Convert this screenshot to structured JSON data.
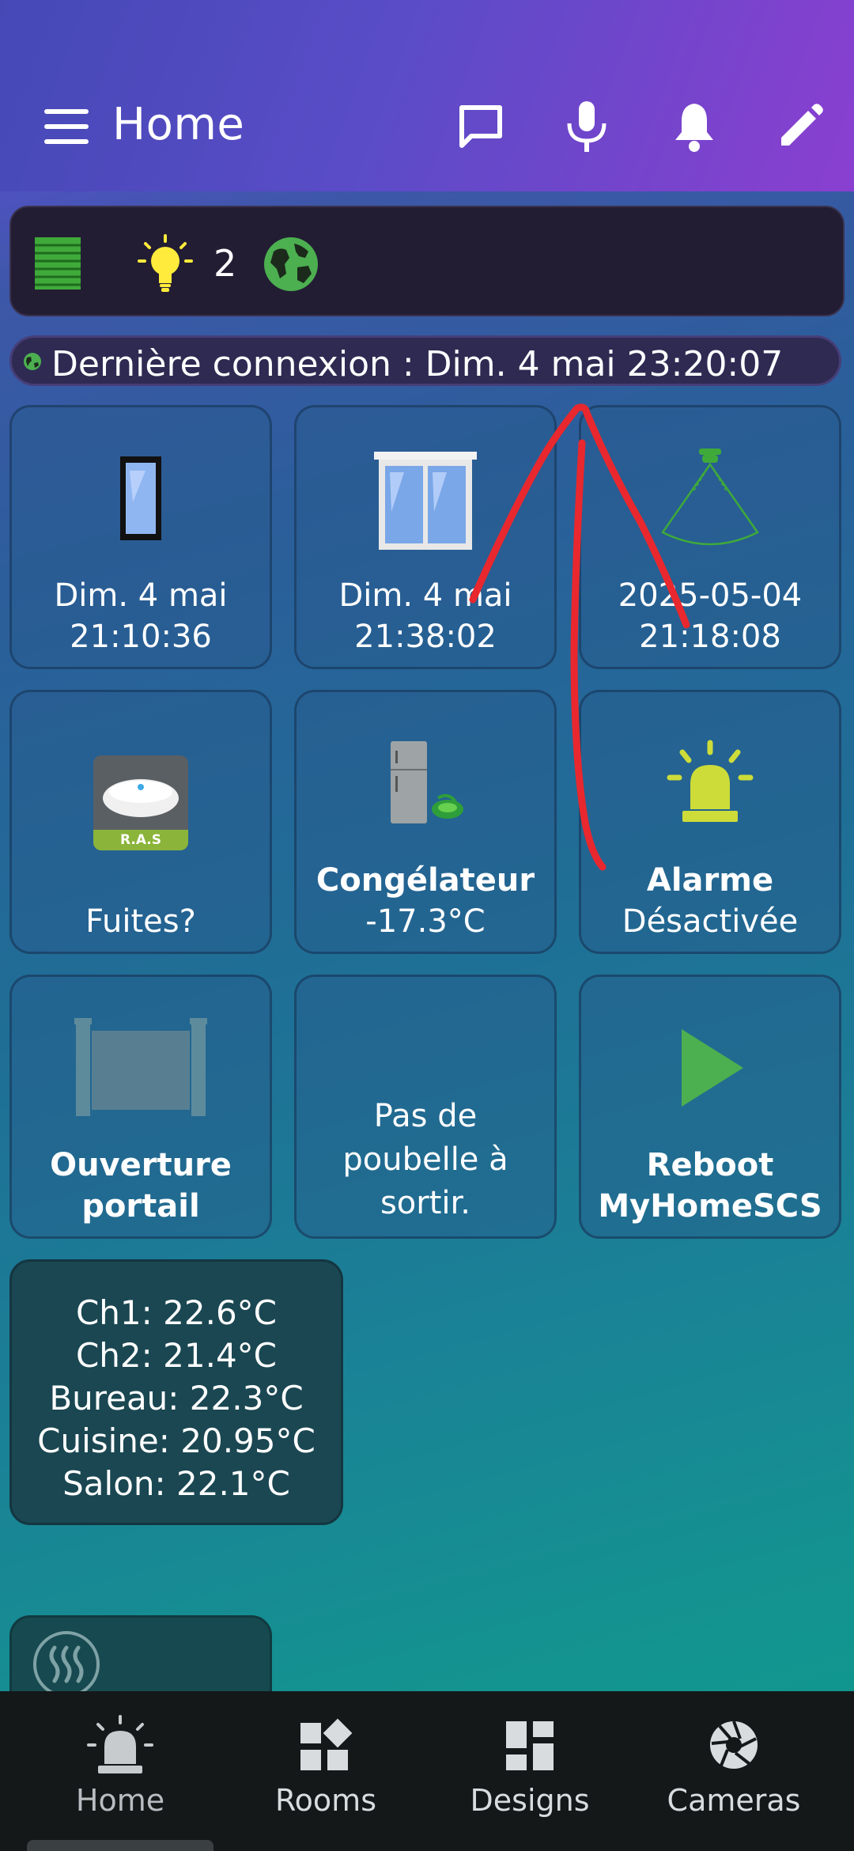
{
  "header": {
    "title": "Home",
    "menu_icon": "menu-icon",
    "actions": [
      "chat-icon",
      "microphone-icon",
      "bell-icon",
      "pencil-icon"
    ]
  },
  "statusbar": {
    "light_count": "2",
    "icons": [
      "shutter-icon",
      "lightbulb-icon",
      "globe-icon"
    ]
  },
  "last_connection": {
    "text": "Dernière connexion : Dim. 4 mai 23:20:07"
  },
  "tiles": [
    {
      "name": "door",
      "icon": "door-icon",
      "line1": "Dim. 4 mai",
      "line2": "21:10:36"
    },
    {
      "name": "window",
      "icon": "window-icon",
      "line1": "Dim. 4 mai",
      "line2": "21:38:02"
    },
    {
      "name": "motion",
      "icon": "motion-sensor-icon",
      "line1": "2025-05-04",
      "line2": "21:18:08"
    },
    {
      "name": "leak",
      "icon": "leak-sensor-icon",
      "badge": "R.A.S",
      "line1": "Fuites?"
    },
    {
      "name": "freezer",
      "icon": "fridge-icon",
      "bold": "Congélateur",
      "line2": "-17.3°C"
    },
    {
      "name": "alarm",
      "icon": "alarm-icon",
      "bold": "Alarme",
      "line2": "Désactivée"
    },
    {
      "name": "gate",
      "icon": "gate-icon",
      "bold": "Ouverture",
      "bold2": "portail"
    },
    {
      "name": "trash",
      "line1": "Pas de",
      "line2": "poubelle à",
      "line3": "sortir."
    },
    {
      "name": "reboot",
      "icon": "play-icon",
      "bold": "Reboot",
      "bold2": "MyHomeSCS"
    }
  ],
  "temperatures": [
    "Ch1: 22.6°C",
    "Ch2: 21.4°C",
    "Bureau: 22.3°C",
    "Cuisine: 20.95°C",
    "Salon: 22.1°C"
  ],
  "bottom_nav": {
    "items": [
      {
        "label": "Home",
        "icon": "siren-icon",
        "active": true
      },
      {
        "label": "Rooms",
        "icon": "rooms-icon",
        "active": false
      },
      {
        "label": "Designs",
        "icon": "designs-icon",
        "active": false
      },
      {
        "label": "Cameras",
        "icon": "camera-shutter-icon",
        "active": false
      }
    ]
  },
  "colors": {
    "header_start": "#4549b6",
    "header_end": "#8a3fd0",
    "accent_green": "#4caf50",
    "bulb_yellow": "#ffeb3b",
    "alarm_yellow": "#cddc39",
    "annotation_red": "#e8282e"
  }
}
